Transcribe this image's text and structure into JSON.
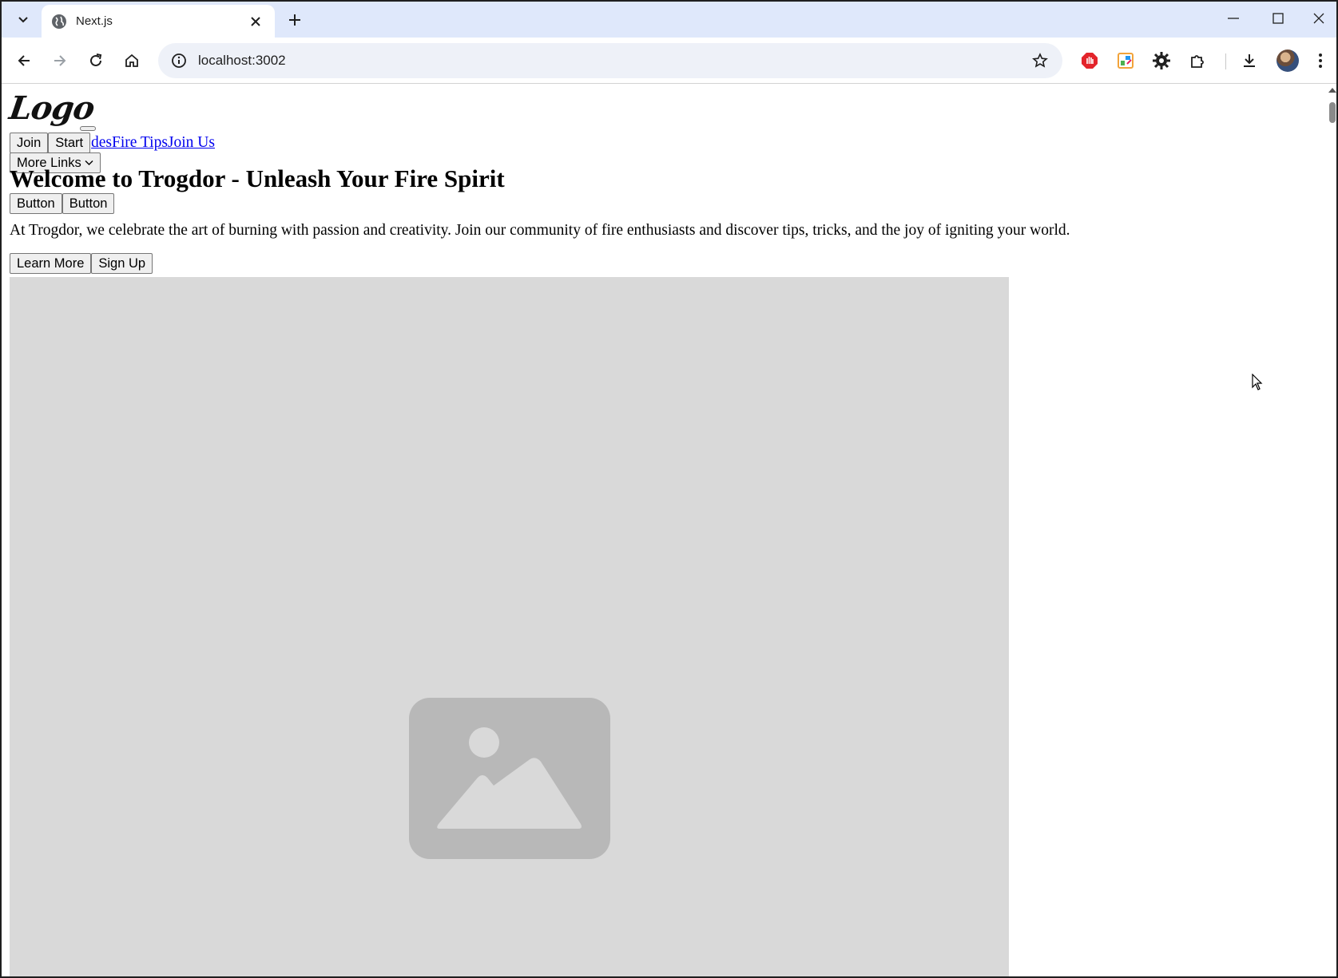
{
  "browser": {
    "tab": {
      "title": "Next.js"
    },
    "address": {
      "url": "localhost:3002"
    }
  },
  "page": {
    "logo": "Logo",
    "header_buttons": [
      "Join",
      "Start"
    ],
    "nav_links": [
      "des",
      "Fire Tips",
      "Join Us"
    ],
    "more_links": "More Links",
    "headline": "Welcome to Trogdor - Unleash Your Fire Spirit",
    "hero_buttons": [
      "Button",
      "Button"
    ],
    "description": "At Trogdor, we celebrate the art of burning with passion and creativity. Join our community of fire enthusiasts and discover tips, tricks, and the joy of igniting your world.",
    "cta_buttons": [
      "Learn More",
      "Sign Up"
    ]
  },
  "colors": {
    "tabstrip": "#dfe8fb",
    "link": "#0000ee",
    "placeholder": "#d9d9d9",
    "placeholder_icon": "#b8b8b8"
  },
  "icons": [
    "tab-search-icon",
    "globe-icon",
    "close-icon",
    "plus-icon",
    "minimize-icon",
    "maximize-icon",
    "back-icon",
    "forward-icon",
    "reload-icon",
    "home-icon",
    "info-icon",
    "star-icon",
    "adblock-icon",
    "color-picker-icon",
    "gear-icon",
    "extensions-icon",
    "download-icon",
    "kebab-menu-icon",
    "chevron-down-icon",
    "image-placeholder-icon",
    "mouse-cursor-icon"
  ]
}
